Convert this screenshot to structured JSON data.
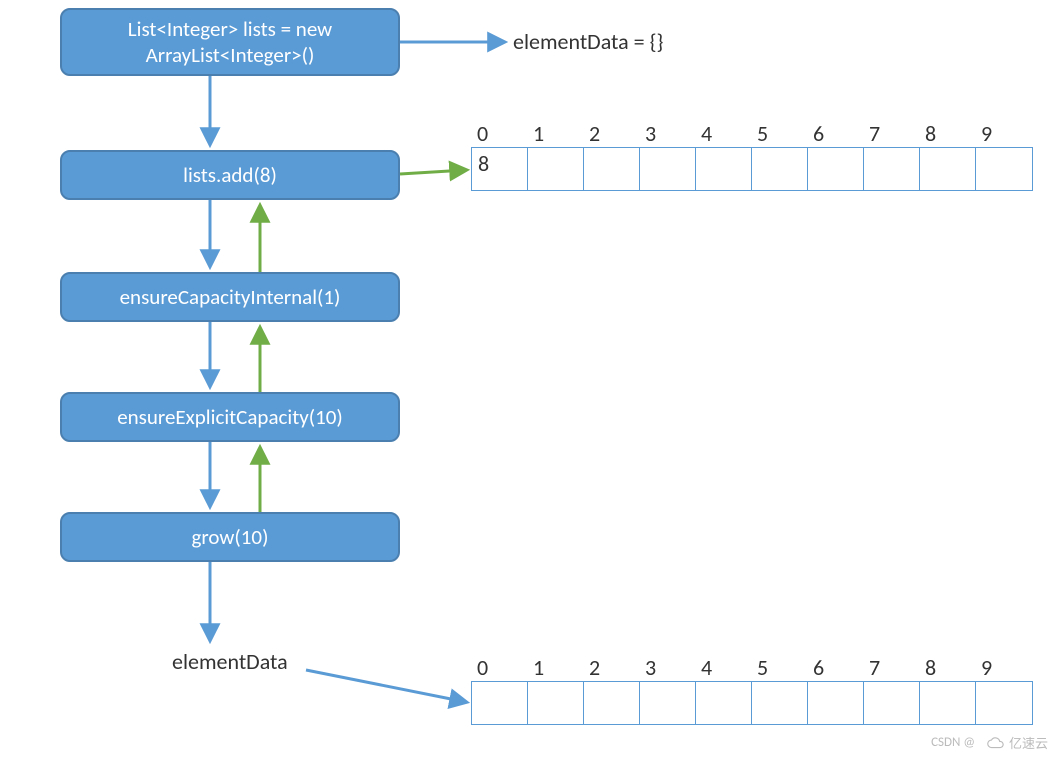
{
  "nodes": {
    "init": {
      "line1": "List<Integer> lists = new",
      "line2": "ArrayList<Integer>()"
    },
    "add": "lists.add(8)",
    "ensureInternal": "ensureCapacityInternal(1)",
    "ensureExplicit": "ensureExplicitCapacity(10)",
    "grow": "grow(10)"
  },
  "labels": {
    "elementDataEmpty": "elementData = {}",
    "elementDataBottom": "elementData"
  },
  "array1": {
    "indices": [
      "0",
      "1",
      "2",
      "3",
      "4",
      "5",
      "6",
      "7",
      "8",
      "9"
    ],
    "cells": [
      "8",
      "",
      "",
      "",
      "",
      "",
      "",
      "",
      "",
      ""
    ]
  },
  "array2": {
    "indices": [
      "0",
      "1",
      "2",
      "3",
      "4",
      "5",
      "6",
      "7",
      "8",
      "9"
    ],
    "cells": [
      "",
      "",
      "",
      "",
      "",
      "",
      "",
      "",
      "",
      ""
    ]
  },
  "watermark": {
    "left": "CSDN @",
    "right": "亿速云"
  },
  "colors": {
    "blue": "#5B9BD5",
    "green": "#70AD47"
  }
}
